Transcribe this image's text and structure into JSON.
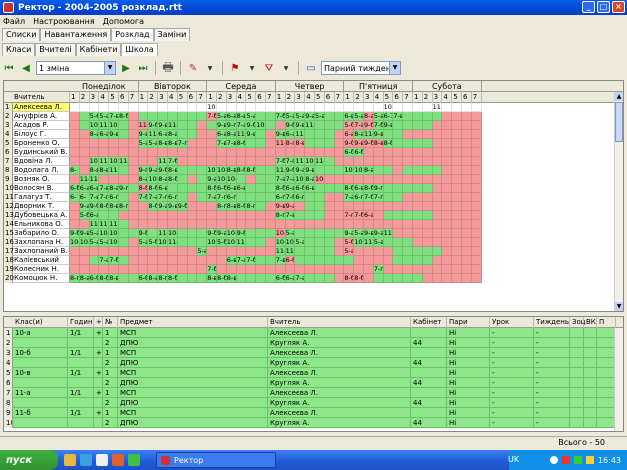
{
  "window": {
    "title": "Ректор - 2004-2005 розклад.rtt",
    "buttons": [
      "_",
      "□",
      "×"
    ]
  },
  "menu": [
    "Файл",
    "Настроювання",
    "Допомога"
  ],
  "tabs_main": [
    "Списки",
    "Навантаження",
    "Розклад",
    "Заміни"
  ],
  "tabs_main_active": 2,
  "tabs_sub": [
    "Класи",
    "Вчителі",
    "Кабінети",
    "Школа"
  ],
  "tabs_sub_active": 3,
  "toolbar": {
    "shift_value": "1 зміна",
    "week_value": "Парний тиждень"
  },
  "days": [
    "Понеділок",
    "Вівторок",
    "Середа",
    "Четвер",
    "П'ятниця",
    "Субота"
  ],
  "lessons": [
    "1",
    "2",
    "3",
    "4",
    "5",
    "6",
    "7"
  ],
  "grid_header_teacher": "Вчитель",
  "teachers": [
    {
      "n": "1",
      "name": "Алексеєва Л.",
      "cells": "wwwwwwwwwwwwwwwwwwwwwwwwwwwwwwwwwwwwwwwwww",
      "txt": {
        "14": "10-",
        "32": "10-",
        "37": "11-"
      }
    },
    {
      "n": "2",
      "name": "Ануфрієв А.",
      "cells": "rgggggrgggggggrgggggggggggggggrgggggggrrrrrr",
      "txt": {
        "2": "5-6",
        "3": "5-а",
        "4": "7-в",
        "5": "8-б",
        "14": "7-б",
        "15": "5-а",
        "16": "6-а",
        "17": "8-в",
        "18": "5-а",
        "21": "7-б",
        "22": "5-а",
        "23": "5-а",
        "24": "9-а",
        "25": "5-а",
        "28": "6-в",
        "29": "5-а",
        "30": "8-а",
        "31": "5-а",
        "32": "6-7",
        "33": "7-в"
      }
    },
    {
      "n": "3",
      "name": "Асадов Р.",
      "cells": "rgggggrrgggggrgggggggrggggggrrrggggggrrrrrr",
      "txt": {
        "2": "10-",
        "3": "11-",
        "4": "10-",
        "7": "11-",
        "8": "9-б",
        "9": "9-в",
        "10": "11-",
        "15": "9-в",
        "16": "9-г",
        "17": "7-а",
        "18": "9-б",
        "19": "10-",
        "22": "9-б",
        "23": "9-в",
        "24": "11-",
        "28": "5-б",
        "29": "7-а",
        "30": "9-б",
        "31": "7-б",
        "32": "9-в"
      }
    },
    {
      "n": "4",
      "name": "Білоус Г.",
      "cells": "rrggggrggggggrrgggggrggggggrrgggggrrrrrrrr",
      "txt": {
        "2": "8-а",
        "3": "6-а",
        "4": "9-в",
        "7": "9-в",
        "8": "11-",
        "9": "6-а",
        "10": "8-а",
        "15": "6-а",
        "16": "8-а",
        "17": "11-",
        "18": "9-в",
        "21": "9-в",
        "22": "6-а",
        "23": "11-",
        "28": "6-а",
        "29": "8-а",
        "30": "11-",
        "31": "9-в"
      }
    },
    {
      "n": "5",
      "name": "Броненко О.",
      "cells": "rrrrrrrgggggrrrgggggrrrrgggrrrrrgggggrrrrr",
      "txt": {
        "7": "5-а",
        "8": "5-а",
        "9": "8-в",
        "10": "8-в",
        "11": "7-г",
        "15": "7-в",
        "16": "7-в",
        "17": "8-б",
        "21": "11-",
        "22": "8-г",
        "23": "8-в",
        "28": "9-б",
        "29": "9-в",
        "30": "9-б",
        "31": "8-в",
        "32": "8-б"
      }
    },
    {
      "n": "6",
      "name": "Будинський В.",
      "cells": "rrrrrrrrrrrrrrrrrrrrrrrrrrrrggrrrrrrrrrrrr",
      "txt": {
        "28": "6-б",
        "29": "6-б"
      }
    },
    {
      "n": "7",
      "name": "Вдовіна Л.",
      "cells": "rrggggrrrggrrrrrrrrrrggggggrrrrrrrrrrrrrrr",
      "txt": {
        "2": "10-",
        "3": "11-",
        "4": "10-",
        "5": "11-",
        "9": "11-",
        "10": "7-б",
        "21": "7-б",
        "22": "7-г",
        "23": "11-",
        "24": "10-",
        "25": "11-"
      }
    },
    {
      "n": "8",
      "name": "Водолага Л.",
      "cells": "grggggrggggggggggggggggggggggggggrggggrrrrr",
      "txt": {
        "0": "8-",
        "2": "8-в",
        "3": "8-в",
        "4": "11-",
        "7": "9-г",
        "8": "9-а",
        "9": "9-б",
        "10": "8-в",
        "14": "10-",
        "15": "10-",
        "16": "8-в",
        "17": "8-б",
        "18": "8-б",
        "21": "11-",
        "22": "9-б",
        "23": "9-а",
        "24": "9-в",
        "28": "10-",
        "29": "10-",
        "30": "8-а"
      }
    },
    {
      "n": "9",
      "name": "Возняк О.",
      "cells": "rggrrrrgggggrgggggrggggggrrrrrrrrrrrrrrrr",
      "txt": {
        "1": "11-",
        "2": "11-",
        "7": "8-а",
        "8": "10-",
        "9": "8-а",
        "10": "8-б",
        "14": "9-а",
        "15": "10-",
        "16": "10-",
        "21": "7-а",
        "22": "7-а",
        "23": "10-",
        "24": "8-а",
        "25": "10-"
      }
    },
    {
      "n": "10",
      "name": "Волосян В.",
      "cells": "gggggggrgggggggggggggggggggggggggggggrrrrr",
      "txt": {
        "0": "6-б",
        "1": "6-а",
        "2": "6-в",
        "3": "7-в",
        "4": "8-а",
        "5": "9-г",
        "7": "8-б",
        "8": "8-б",
        "9": "6-в",
        "14": "8-б",
        "15": "6-б",
        "16": "6-в",
        "17": "6-в",
        "21": "8-б",
        "22": "6-в",
        "23": "6-б",
        "24": "6-в",
        "28": "8-б",
        "29": "6-в",
        "30": "8-б",
        "31": "9-г"
      }
    },
    {
      "n": "11",
      "name": "Галагуз Т.",
      "cells": "ggggggrgggggrgggggggggggggrrggggggrrrrrrr",
      "txt": {
        "0": "6-",
        "1": "6-",
        "2": "7-в",
        "3": "7-г",
        "4": "6-г",
        "7": "7-б",
        "8": "7-а",
        "9": "7-г",
        "10": "6-г",
        "14": "7-а",
        "15": "7-г",
        "16": "6-г",
        "21": "6-г",
        "22": "7-б",
        "23": "6-г",
        "28": "7-а",
        "29": "6-г",
        "30": "7-б",
        "31": "7-г"
      }
    },
    {
      "n": "12",
      "name": "Дворник Т.",
      "cells": "rgggggrrggggrrrgggggrrrrggrrrrrrrrrrrrrrrr",
      "txt": {
        "1": "9-а",
        "2": "9-б",
        "3": "8-б",
        "4": "8-в",
        "5": "8-г",
        "8": "8-б",
        "9": "9-а",
        "10": "9-в",
        "11": "9-б",
        "15": "8-г",
        "16": "8-в",
        "17": "8-б",
        "18": "8-г",
        "21": "9-в",
        "22": "9-а"
      }
    },
    {
      "n": "13",
      "name": "Дубовецька А.",
      "cells": "rggggrrrrrrrrrrrrrrrrgggggrrrrrrgggggrrrrr",
      "txt": {
        "1": "5-б",
        "2": "6-а",
        "21": "8-г",
        "22": "7-в",
        "28": "7-г",
        "29": "7-б",
        "30": "6-а"
      }
    },
    {
      "n": "14",
      "name": "Ельникова О.",
      "cells": "rrggggrrrrrrrrrrrrrrrrrrrrrrrrrrrrrrrrrrrrr",
      "txt": {
        "2": "11-",
        "3": "11-",
        "4": "11-"
      }
    },
    {
      "n": "15",
      "name": "Забарило О.",
      "cells": "gggggggggggggggggggggrgggggggggggrrrrrrrrr",
      "txt": {
        "0": "9-б",
        "1": "9-в",
        "2": "5-а",
        "3": "10-",
        "4": "10-",
        "7": "9-б",
        "9": "11-",
        "10": "10-",
        "14": "9-б",
        "15": "9-а",
        "16": "10-",
        "17": "9-б",
        "21": "10-",
        "22": "5-а",
        "28": "9-а",
        "29": "5-а",
        "30": "9-в",
        "31": "9-а",
        "32": "11-"
      }
    },
    {
      "n": "16",
      "name": "Захлопана Н.",
      "cells": "ggggggrgggggggggggggrggggggrrggggggrrrrrrr",
      "txt": {
        "0": "10-",
        "1": "10-",
        "2": "5-а",
        "3": "5-а",
        "4": "10-",
        "7": "5-а",
        "8": "5-б",
        "9": "10-",
        "10": "11-",
        "14": "10-",
        "15": "5-б",
        "16": "10-",
        "17": "11-",
        "21": "10-",
        "22": "10-",
        "23": "5-а",
        "28": "5-б",
        "29": "10-",
        "30": "11-",
        "31": "5-а"
      }
    },
    {
      "n": "17",
      "name": "Захлопаний В.",
      "cells": "rrrrrrrrrrrrrgrrrrrrrggggggrrrrrrgggggrrrrr",
      "txt": {
        "13": "5-а",
        "21": "11-",
        "22": "11-",
        "28": "5-а"
      }
    },
    {
      "n": "18",
      "name": "Калієвський",
      "cells": "rrggggrrrrrrrrrrggggggrggggggrrrrggggrrrrr",
      "txt": {
        "3": "7-а",
        "4": "7-б",
        "16": "6-в",
        "17": "7-а",
        "18": "7-б",
        "21": "7-в",
        "22": "6-б"
      }
    },
    {
      "n": "19",
      "name": "Колесник Н.",
      "cells": "rrrrrrrrrrrrrrgrrrrrrrrrrrrrrrrgrrrrrrrrrr",
      "txt": {
        "14": "7-б",
        "31": "7-г"
      }
    },
    {
      "n": "20",
      "name": "Комоцюк Н.",
      "cells": "gggggggggggggggggggggggggggrrrrgggggrrrrrrr",
      "txt": {
        "0": "8-г",
        "1": "8-а",
        "2": "6-б",
        "3": "8-б",
        "4": "8-в",
        "7": "6-б",
        "8": "8-а",
        "9": "8-г",
        "10": "8-б",
        "14": "8-в",
        "15": "8-б",
        "16": "8-в",
        "21": "6-б",
        "22": "6-а",
        "23": "7-а",
        "28": "8-б",
        "29": "8-б"
      }
    }
  ],
  "bottom_headers": [
    "Клас(и)",
    "Годин",
    "+",
    "№",
    "Предмет",
    "Вчитель",
    "Кабінет",
    "Пари",
    "Урок",
    "Тиждень",
    "Зоц",
    "ВК",
    "П"
  ],
  "bottom_rows": [
    {
      "n": "1",
      "cls": "10-а",
      "hours": "1/1",
      "plus": "+",
      "no": "1",
      "subj": "МСП",
      "teacher": "Алексеєва Л.",
      "room": "",
      "pairs": "Ні",
      "lesson": "-",
      "week": "-"
    },
    {
      "n": "2",
      "cls": "",
      "hours": "",
      "plus": "",
      "no": "2",
      "subj": "ДПЮ",
      "teacher": "Кругляк А.",
      "room": "44",
      "pairs": "Ні",
      "lesson": "-",
      "week": "-"
    },
    {
      "n": "3",
      "cls": "10-б",
      "hours": "1/1",
      "plus": "+",
      "no": "1",
      "subj": "МСП",
      "teacher": "Алексеєва Л.",
      "room": "",
      "pairs": "Ні",
      "lesson": "-",
      "week": "-"
    },
    {
      "n": "4",
      "cls": "",
      "hours": "",
      "plus": "",
      "no": "2",
      "subj": "ДПЮ",
      "teacher": "Кругляк А.",
      "room": "44",
      "pairs": "Ні",
      "lesson": "-",
      "week": "-"
    },
    {
      "n": "5",
      "cls": "10-в",
      "hours": "1/1",
      "plus": "+",
      "no": "1",
      "subj": "МСП",
      "teacher": "Алексеєва Л.",
      "room": "",
      "pairs": "Ні",
      "lesson": "-",
      "week": "-"
    },
    {
      "n": "6",
      "cls": "",
      "hours": "",
      "plus": "",
      "no": "2",
      "subj": "ДПЮ",
      "teacher": "Кругляк А.",
      "room": "44",
      "pairs": "Ні",
      "lesson": "-",
      "week": "-"
    },
    {
      "n": "7",
      "cls": "11-а",
      "hours": "1/1",
      "plus": "+",
      "no": "1",
      "subj": "МСП",
      "teacher": "Алексеєва Л.",
      "room": "",
      "pairs": "Ні",
      "lesson": "-",
      "week": "-"
    },
    {
      "n": "8",
      "cls": "",
      "hours": "",
      "plus": "",
      "no": "2",
      "subj": "ДПЮ",
      "teacher": "Кругляк А.",
      "room": "44",
      "pairs": "Ні",
      "lesson": "-",
      "week": "-"
    },
    {
      "n": "9",
      "cls": "11-б",
      "hours": "1/1",
      "plus": "+",
      "no": "1",
      "subj": "МСП",
      "teacher": "Алексеєва Л.",
      "room": "",
      "pairs": "Ні",
      "lesson": "-",
      "week": "-"
    },
    {
      "n": "10",
      "cls": "",
      "hours": "",
      "plus": "",
      "no": "2",
      "subj": "ДПЮ",
      "teacher": "Кругляк А.",
      "room": "44",
      "pairs": "Ні",
      "lesson": "-",
      "week": "-"
    }
  ],
  "status": {
    "total": "Всього - 50"
  },
  "taskbar": {
    "start": "пуск",
    "task": "Ректор",
    "lang": "UK",
    "clock": "16:43"
  },
  "colors": {
    "green": "#7ee07e",
    "red": "#f59a9a",
    "bottom_green": "#8ee68a"
  }
}
